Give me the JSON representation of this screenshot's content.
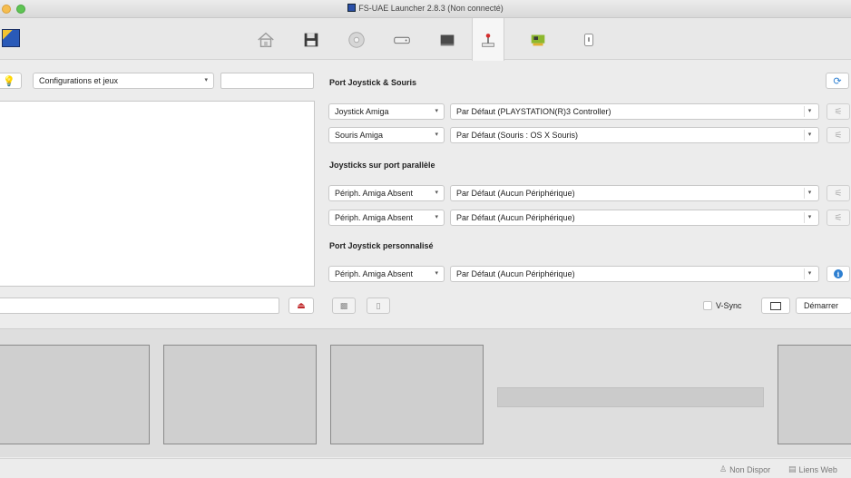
{
  "window": {
    "title": "FS-UAE Launcher 2.8.3 (Non connecté)"
  },
  "toolbar": {
    "icons": [
      "home-icon",
      "floppy-icon",
      "cd-icon",
      "harddrive-icon",
      "hardware-icon",
      "joystick-icon",
      "expansion-card-icon",
      "misc-icon"
    ],
    "active": "joystick-icon"
  },
  "left_panel": {
    "config_select": "Configurations et jeux",
    "search_value": "",
    "bottom_value": ""
  },
  "right_panel": {
    "section_ports": "Port Joystick & Souris",
    "ports": [
      {
        "type": "Joystick Amiga",
        "device": "Par Défaut (PLAYSTATION(R)3 Controller)"
      },
      {
        "type": "Souris Amiga",
        "device": "Par Défaut (Souris : OS X Souris)"
      }
    ],
    "section_parallel": "Joysticks sur port parallèle",
    "parallel": [
      {
        "type": "Périph. Amiga Absent",
        "device": "Par Défaut (Aucun Périphérique)"
      },
      {
        "type": "Périph. Amiga Absent",
        "device": "Par Défaut (Aucun Périphérique)"
      }
    ],
    "section_custom": "Port Joystick personnalisé",
    "custom": [
      {
        "type": "Périph. Amiga Absent",
        "device": "Par Défaut (Aucun Périphérique)"
      }
    ],
    "vsync_label": "V-Sync",
    "vsync_checked": false,
    "start_label": "Démarrer"
  },
  "statusbar": {
    "status_1": "Non Dispor",
    "status_2": "Liens Web"
  },
  "colors": {
    "accent": "#2d7fd1",
    "eject": "#c0282a"
  }
}
